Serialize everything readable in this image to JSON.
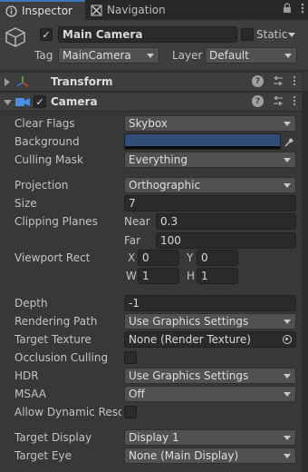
{
  "tabs": [
    {
      "label": "Inspector",
      "icon": "info-icon",
      "active": true
    },
    {
      "label": "Navigation",
      "icon": "navigation-icon",
      "active": false
    }
  ],
  "header": {
    "object_name": "Main Camera",
    "static_label": "Static",
    "tag_label": "Tag",
    "tag_value": "MainCamera",
    "layer_label": "Layer",
    "layer_value": "Default"
  },
  "components": {
    "transform": {
      "title": "Transform"
    },
    "camera": {
      "title": "Camera"
    }
  },
  "camera": {
    "clear_flags": {
      "label": "Clear Flags",
      "value": "Skybox"
    },
    "background": {
      "label": "Background",
      "color": "#304e78"
    },
    "culling_mask": {
      "label": "Culling Mask",
      "value": "Everything"
    },
    "projection": {
      "label": "Projection",
      "value": "Orthographic"
    },
    "size": {
      "label": "Size",
      "value": "7"
    },
    "clipping_planes": {
      "label": "Clipping Planes",
      "near_label": "Near",
      "near": "0.3",
      "far_label": "Far",
      "far": "100"
    },
    "viewport_rect": {
      "label": "Viewport Rect",
      "x_label": "X",
      "x": "0",
      "y_label": "Y",
      "y": "0",
      "w_label": "W",
      "w": "1",
      "h_label": "H",
      "h": "1"
    },
    "depth": {
      "label": "Depth",
      "value": "-1"
    },
    "rendering_path": {
      "label": "Rendering Path",
      "value": "Use Graphics Settings"
    },
    "target_texture": {
      "label": "Target Texture",
      "value": "None (Render Texture)"
    },
    "occlusion_culling": {
      "label": "Occlusion Culling"
    },
    "hdr": {
      "label": "HDR",
      "value": "Use Graphics Settings"
    },
    "msaa": {
      "label": "MSAA",
      "value": "Off"
    },
    "allow_dynamic_resol": {
      "label": "Allow Dynamic Resol"
    },
    "target_display": {
      "label": "Target Display",
      "value": "Display 1"
    },
    "target_eye": {
      "label": "Target Eye",
      "value": "None (Main Display)"
    }
  },
  "colors": {
    "accent": "#3a79bb",
    "panel": "#383838",
    "camera_icon": "#4a90e2"
  }
}
